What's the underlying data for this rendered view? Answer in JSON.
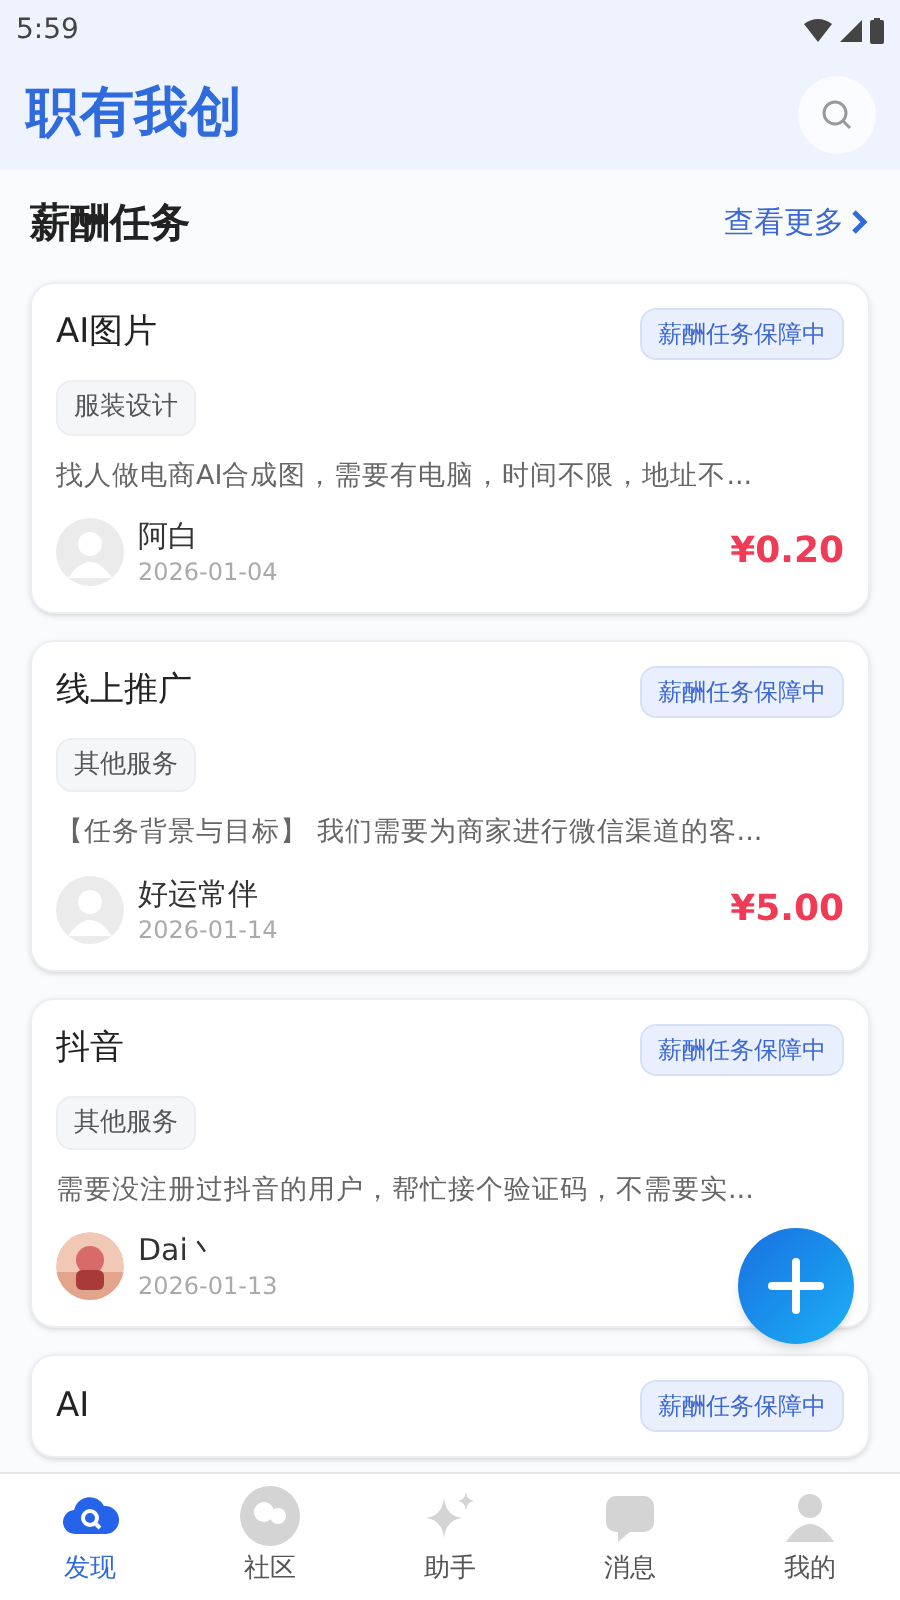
{
  "status_bar": {
    "time": "5:59"
  },
  "header": {
    "title": "职有我创"
  },
  "section": {
    "title": "薪酬任务",
    "more": "查看更多"
  },
  "tasks": [
    {
      "title": "AI图片",
      "badge": "薪酬任务保障中",
      "tag": "服装设计",
      "description": "找人做电商AI合成图，需要有电脑，时间不限，地址不...",
      "user": "阿白",
      "date": "2026-01-04",
      "price": "¥0.20",
      "avatar": {
        "kind": "default"
      }
    },
    {
      "title": "线上推广",
      "badge": "薪酬任务保障中",
      "tag": "其他服务",
      "description": "【任务背景与目标】 我们需要为商家进行微信渠道的客...",
      "user": "好运常伴",
      "date": "2026-01-14",
      "price": "¥5.00",
      "avatar": {
        "kind": "default"
      }
    },
    {
      "title": "抖音",
      "badge": "薪酬任务保障中",
      "tag": "其他服务",
      "description": "需要没注册过抖音的用户，帮忙接个验证码，不需要实...",
      "user": "Dai丶",
      "date": "2026-01-13"
    },
    {
      "title": "AI",
      "badge": "薪酬任务保障中"
    }
  ],
  "nav": [
    {
      "label": "发现",
      "selected": true,
      "kind": "discover"
    },
    {
      "label": "社区",
      "selected": false,
      "kind": "community"
    },
    {
      "label": "助手",
      "selected": false,
      "kind": "assistant"
    },
    {
      "label": "消息",
      "selected": false,
      "kind": "messages"
    },
    {
      "label": "我的",
      "selected": false,
      "kind": "profile"
    }
  ]
}
